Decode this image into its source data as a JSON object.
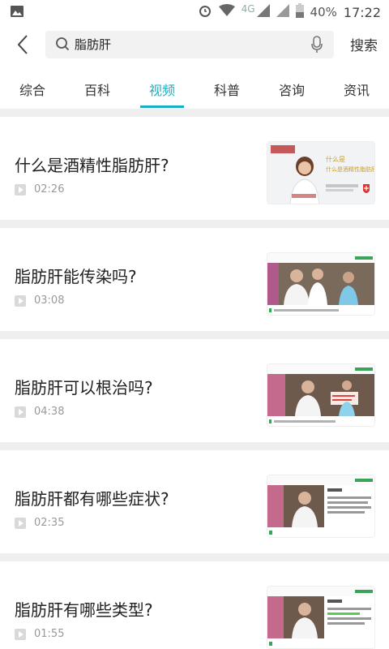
{
  "status_bar": {
    "network": "4G",
    "battery": "40%",
    "time": "17:22"
  },
  "search": {
    "query": "脂肪肝",
    "button_label": "搜索"
  },
  "tabs": [
    {
      "label": "综合",
      "active": false
    },
    {
      "label": "百科",
      "active": false
    },
    {
      "label": "视频",
      "active": true
    },
    {
      "label": "科普",
      "active": false
    },
    {
      "label": "咨询",
      "active": false
    },
    {
      "label": "资讯",
      "active": false
    }
  ],
  "accent_color": "#18b0c6",
  "videos": [
    {
      "title": "什么是酒精性脂肪肝?",
      "duration": "02:26",
      "thumb_caption": "什么是酒精性脂肪肝?"
    },
    {
      "title": "脂肪肝能传染吗?",
      "duration": "03:08"
    },
    {
      "title": "脂肪肝可以根治吗?",
      "duration": "04:38"
    },
    {
      "title": "脂肪肝都有哪些症状?",
      "duration": "02:35"
    },
    {
      "title": "脂肪肝有哪些类型?",
      "duration": "01:55"
    }
  ]
}
